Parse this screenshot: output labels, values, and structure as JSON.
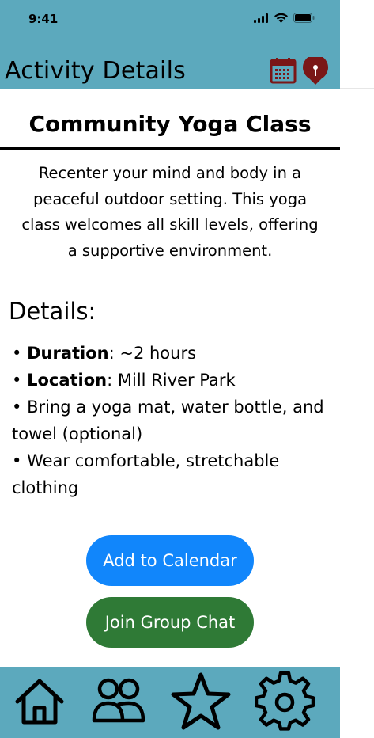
{
  "status_bar": {
    "time": "9:41"
  },
  "header": {
    "title": "Activity Details",
    "calendar_icon": "calendar-icon",
    "map_pin_icon": "map-pin-icon",
    "accent_color": "#7a1717"
  },
  "activity": {
    "title": "Community Yoga Class",
    "description": "Recenter your mind and body in a peaceful outdoor setting. This yoga class welcomes all skill levels, offering a supportive environment."
  },
  "details": {
    "heading": "Details:",
    "duration_label": "Duration",
    "duration_value": ": ~2 hours",
    "location_label": "Location",
    "location_value": ": Mill River Park",
    "bring_item": "Bring a yoga mat, water bottle, and towel (optional)",
    "wear_item": "Wear comfortable, stretchable clothing",
    "bullet": "•"
  },
  "actions": {
    "add_to_calendar": "Add to Calendar",
    "join_group_chat": "Join Group Chat",
    "add_color": "#1186fb",
    "chat_color": "#2f7a36"
  },
  "tab_bar": {
    "items": [
      {
        "icon": "home-icon"
      },
      {
        "icon": "group-icon"
      },
      {
        "icon": "star-icon"
      },
      {
        "icon": "settings-icon"
      }
    ],
    "color": "#5ca9bd"
  }
}
